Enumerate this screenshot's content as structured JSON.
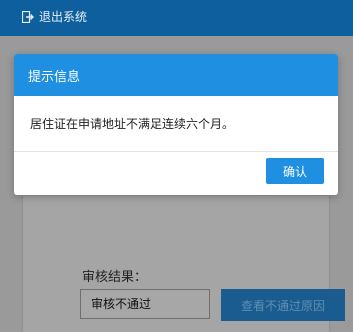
{
  "topbar": {
    "logout_label": "退出系统"
  },
  "page": {
    "result_label": "审核结果：",
    "result_value": "审核不通过",
    "reason_button": "查看不通过原因"
  },
  "dialog": {
    "title": "提示信息",
    "message": "居住证在申请地址不满足连续六个月。",
    "ok_label": "确认"
  },
  "colors": {
    "header_blue": "#0d5f9e",
    "dialog_blue": "#1e8fe1"
  }
}
